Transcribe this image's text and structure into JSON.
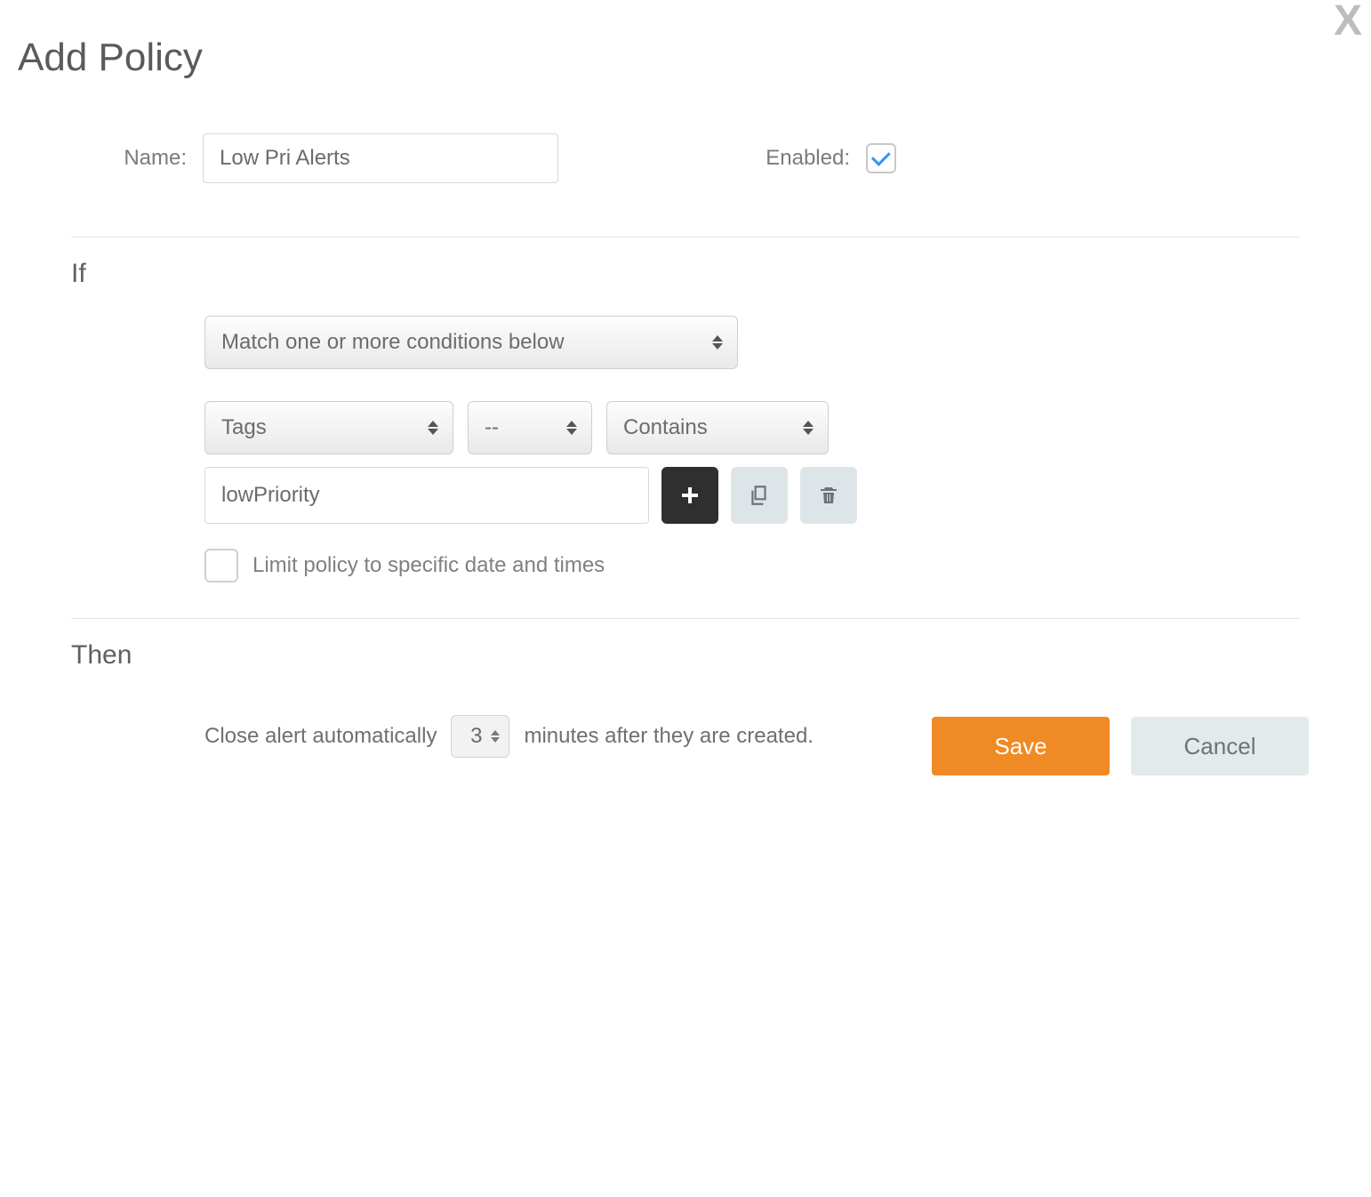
{
  "dialog": {
    "title": "Add Policy",
    "close_symbol": "X",
    "name_label": "Name:",
    "name_value": "Low Pri Alerts",
    "enabled_label": "Enabled:",
    "enabled_checked": true
  },
  "if": {
    "heading": "If",
    "match_mode": "Match one or more conditions below",
    "condition": {
      "attribute": "Tags",
      "operator": "--",
      "comparator": "Contains",
      "value": "lowPriority"
    },
    "limit_checked": false,
    "limit_label": "Limit policy to specific date and times"
  },
  "then": {
    "heading": "Then",
    "prefix": "Close alert automatically",
    "minutes_value": "3",
    "suffix": "minutes after they are created."
  },
  "buttons": {
    "save": "Save",
    "cancel": "Cancel"
  }
}
